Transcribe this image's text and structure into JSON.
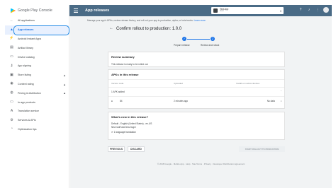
{
  "brand": {
    "name": "Google Play Console"
  },
  "header": {
    "title": "App releases",
    "app_name": "Test App",
    "app_package": "fixed",
    "help_icon": "help-icon",
    "notifications_icon": "bell-icon",
    "apps_icon": "apps-grid-icon"
  },
  "sidebar": {
    "items": [
      {
        "label": "All applications",
        "icon": "back-arrow-icon"
      },
      {
        "label": "App releases",
        "icon": "rocket-icon"
      },
      {
        "label": "Android Instant Apps",
        "icon": "instant-icon"
      },
      {
        "label": "Artifact library",
        "icon": "library-icon"
      },
      {
        "label": "Device catalog",
        "icon": "devices-icon"
      },
      {
        "label": "App signing",
        "icon": "key-icon"
      },
      {
        "label": "Store listing",
        "icon": "store-icon"
      },
      {
        "label": "Content rating",
        "icon": "rating-icon"
      },
      {
        "label": "Pricing & distribution",
        "icon": "globe-icon"
      },
      {
        "label": "In-app products",
        "icon": "cart-icon"
      },
      {
        "label": "Translation service",
        "icon": "translate-icon"
      },
      {
        "label": "Services & APIs",
        "icon": "services-icon"
      },
      {
        "label": "Optimization tips",
        "icon": "lightbulb-icon"
      }
    ]
  },
  "main": {
    "intro": "Manage your app's APKs, review release history, and roll out your app to production, alpha, or beta tracks.",
    "learn_more": "Learn more",
    "title": "Confirm rollout to production: 1.0.0",
    "steps": [
      "Prepare release",
      "Review and rollout"
    ],
    "review_summary": {
      "heading": "Review summary",
      "text": "This release is ready to be rolled out."
    },
    "apks": {
      "heading": "APKs in this release",
      "columns": [
        "Version code",
        "Uploaded",
        "Installs on active devices"
      ],
      "row_group": "1 APK added",
      "row": {
        "version": "84",
        "uploaded": "2 minutes ago",
        "installs": "No data"
      }
    },
    "whats_new": {
      "heading": "What's new in this release?",
      "line1": "Default - English (United States) - en-US",
      "line2": "New stuff and less bugs!",
      "translations": "1 language translation"
    },
    "buttons": {
      "previous": "PREVIOUS",
      "discard": "DISCARD",
      "start": "START ROLLOUT TO PRODUCTION"
    },
    "footer": "© 2018 Google · Mobile App · Help · Site Terms · Privacy · Developer Distribution Agreement"
  }
}
